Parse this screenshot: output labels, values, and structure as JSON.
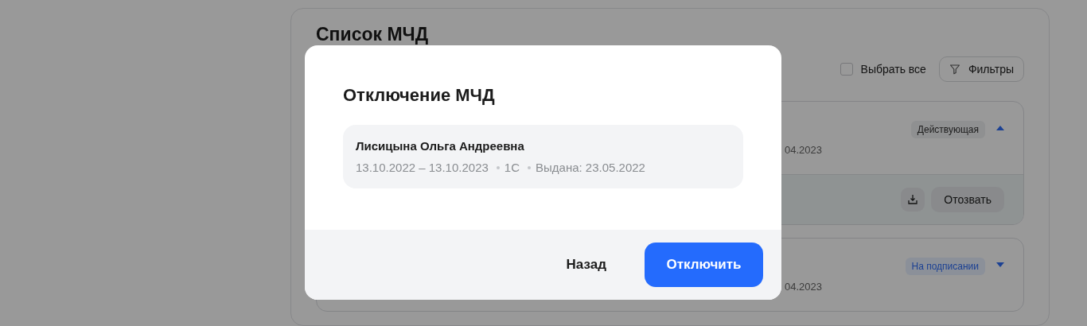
{
  "list": {
    "title": "Список МЧД",
    "select_all": {
      "label": "Выбрать все",
      "checked": false
    },
    "filter_button": "Фильтры",
    "cards": [
      {
        "date_fragment": "04.2023",
        "status": {
          "label": "Действующая",
          "kind": "active"
        },
        "expanded": true,
        "actions": {
          "revoke": "Отозвать"
        }
      },
      {
        "date_fragment": "04.2023",
        "status": {
          "label": "На подписании",
          "kind": "signing"
        },
        "expanded": false
      }
    ]
  },
  "dialog": {
    "title": "Отключение МЧД",
    "person": {
      "name": "Лисицына Ольга Андреевна",
      "period": "13.10.2022 – 13.10.2023",
      "system": "1С",
      "issued": "Выдана: 23.05.2022"
    },
    "buttons": {
      "back": "Назад",
      "confirm": "Отключить"
    }
  }
}
